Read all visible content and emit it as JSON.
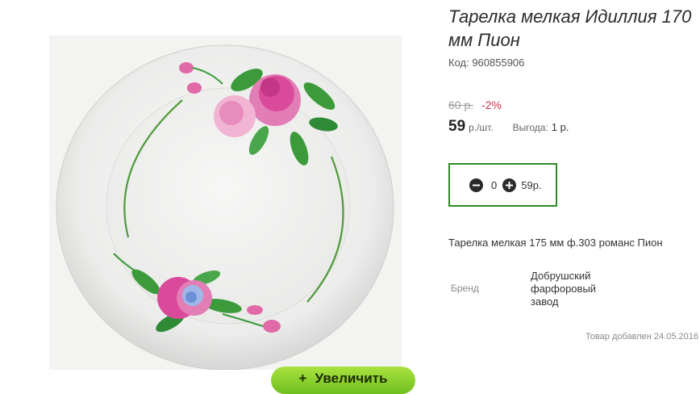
{
  "product": {
    "title": "Тарелка мелкая Идиллия 170 мм Пион",
    "code": "Код: 960855906",
    "old_price": "60 р.",
    "discount": "-2%",
    "price": "59",
    "price_unit": "р./шт.",
    "benefit_label": "Выгода:",
    "benefit_value": "1 р.",
    "description": "Тарелка мелкая 175 мм ф.303 романс Пион",
    "brand_label": "Бренд",
    "brand_value": "Добрушский фарфоровый завод",
    "added_date": "Товар добавлен 24.05.2016"
  },
  "cart": {
    "quantity": "0",
    "sum": "59р.",
    "minus_icon": "minus-circle-icon",
    "plus_icon": "plus-circle-icon"
  },
  "gallery": {
    "zoom_plus": "+",
    "zoom_label": "Увеличить"
  },
  "colors": {
    "zoom_button": "#8fd22e",
    "cart_border": "#2e8b27",
    "discount": "#d6334b",
    "flower_pink": "#d94a9a",
    "leaf_green": "#3c9a3a"
  }
}
